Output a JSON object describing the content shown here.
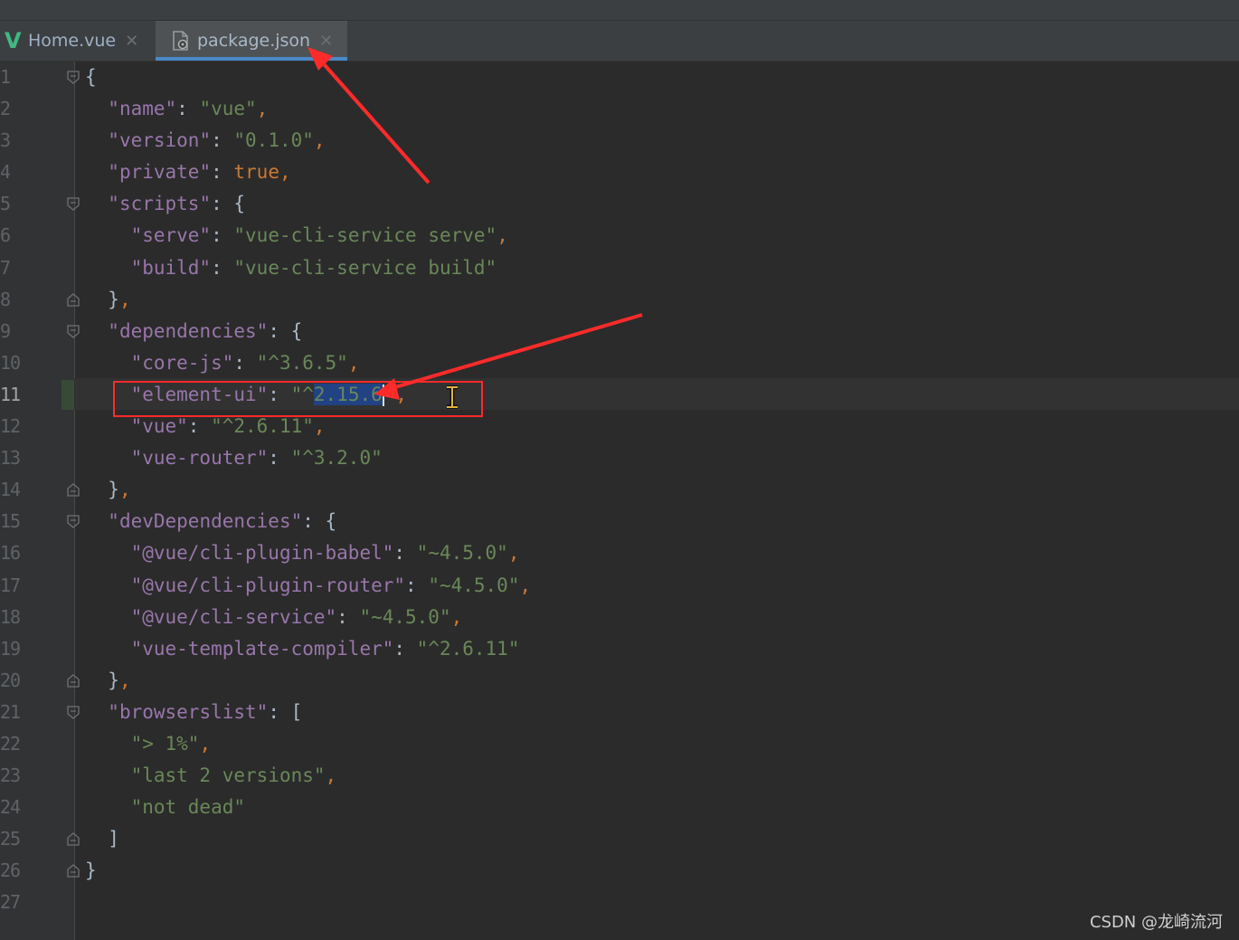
{
  "tabs": [
    {
      "label": "Home.vue",
      "icon": "vue-icon",
      "active": false
    },
    {
      "label": "package.json",
      "icon": "json-file-icon",
      "active": true
    }
  ],
  "editor": {
    "current_line": 11,
    "lines": [
      {
        "n": "1",
        "tokens": [
          {
            "t": "brace",
            "v": "{"
          }
        ]
      },
      {
        "n": "2",
        "tokens": [
          {
            "t": "ws",
            "v": "  "
          },
          {
            "t": "key",
            "v": "\"name\""
          },
          {
            "t": "brace",
            "v": ": "
          },
          {
            "t": "str",
            "v": "\"vue\""
          },
          {
            "t": "punc",
            "v": ","
          }
        ]
      },
      {
        "n": "3",
        "tokens": [
          {
            "t": "ws",
            "v": "  "
          },
          {
            "t": "key",
            "v": "\"version\""
          },
          {
            "t": "brace",
            "v": ": "
          },
          {
            "t": "str",
            "v": "\"0.1.0\""
          },
          {
            "t": "punc",
            "v": ","
          }
        ]
      },
      {
        "n": "4",
        "tokens": [
          {
            "t": "ws",
            "v": "  "
          },
          {
            "t": "key",
            "v": "\"private\""
          },
          {
            "t": "brace",
            "v": ": "
          },
          {
            "t": "kw",
            "v": "true"
          },
          {
            "t": "punc",
            "v": ","
          }
        ]
      },
      {
        "n": "5",
        "tokens": [
          {
            "t": "ws",
            "v": "  "
          },
          {
            "t": "key",
            "v": "\"scripts\""
          },
          {
            "t": "brace",
            "v": ": {"
          }
        ]
      },
      {
        "n": "6",
        "tokens": [
          {
            "t": "ws",
            "v": "    "
          },
          {
            "t": "key",
            "v": "\"serve\""
          },
          {
            "t": "brace",
            "v": ": "
          },
          {
            "t": "str",
            "v": "\"vue-cli-service serve\""
          },
          {
            "t": "punc",
            "v": ","
          }
        ]
      },
      {
        "n": "7",
        "tokens": [
          {
            "t": "ws",
            "v": "    "
          },
          {
            "t": "key",
            "v": "\"build\""
          },
          {
            "t": "brace",
            "v": ": "
          },
          {
            "t": "str",
            "v": "\"vue-cli-service build\""
          }
        ]
      },
      {
        "n": "8",
        "tokens": [
          {
            "t": "ws",
            "v": "  "
          },
          {
            "t": "brace",
            "v": "}"
          },
          {
            "t": "punc",
            "v": ","
          }
        ]
      },
      {
        "n": "9",
        "tokens": [
          {
            "t": "ws",
            "v": "  "
          },
          {
            "t": "key",
            "v": "\"dependencies\""
          },
          {
            "t": "brace",
            "v": ": {"
          }
        ]
      },
      {
        "n": "10",
        "tokens": [
          {
            "t": "ws",
            "v": "    "
          },
          {
            "t": "key",
            "v": "\"core-js\""
          },
          {
            "t": "brace",
            "v": ": "
          },
          {
            "t": "str",
            "v": "\"^3.6.5\""
          },
          {
            "t": "punc",
            "v": ","
          }
        ]
      },
      {
        "n": "11",
        "tokens": [
          {
            "t": "ws",
            "v": "    "
          },
          {
            "t": "key",
            "v": "\"element-ui\""
          },
          {
            "t": "brace",
            "v": ": "
          },
          {
            "t": "str",
            "v": "\"^"
          },
          {
            "t": "sel",
            "v": "2.15.6"
          },
          {
            "t": "caret",
            "v": ""
          },
          {
            "t": "str",
            "v": "\""
          },
          {
            "t": "punc",
            "v": ","
          }
        ]
      },
      {
        "n": "12",
        "tokens": [
          {
            "t": "ws",
            "v": "    "
          },
          {
            "t": "key",
            "v": "\"vue\""
          },
          {
            "t": "brace",
            "v": ": "
          },
          {
            "t": "str",
            "v": "\"^2.6.11\""
          },
          {
            "t": "punc",
            "v": ","
          }
        ]
      },
      {
        "n": "13",
        "tokens": [
          {
            "t": "ws",
            "v": "    "
          },
          {
            "t": "key",
            "v": "\"vue-router\""
          },
          {
            "t": "brace",
            "v": ": "
          },
          {
            "t": "str",
            "v": "\"^3.2.0\""
          }
        ]
      },
      {
        "n": "14",
        "tokens": [
          {
            "t": "ws",
            "v": "  "
          },
          {
            "t": "brace",
            "v": "}"
          },
          {
            "t": "punc",
            "v": ","
          }
        ]
      },
      {
        "n": "15",
        "tokens": [
          {
            "t": "ws",
            "v": "  "
          },
          {
            "t": "key",
            "v": "\"devDependencies\""
          },
          {
            "t": "brace",
            "v": ": {"
          }
        ]
      },
      {
        "n": "16",
        "tokens": [
          {
            "t": "ws",
            "v": "    "
          },
          {
            "t": "key",
            "v": "\"@vue/cli-plugin-babel\""
          },
          {
            "t": "brace",
            "v": ": "
          },
          {
            "t": "str",
            "v": "\"~4.5.0\""
          },
          {
            "t": "punc",
            "v": ","
          }
        ]
      },
      {
        "n": "17",
        "tokens": [
          {
            "t": "ws",
            "v": "    "
          },
          {
            "t": "key",
            "v": "\"@vue/cli-plugin-router\""
          },
          {
            "t": "brace",
            "v": ": "
          },
          {
            "t": "str",
            "v": "\"~4.5.0\""
          },
          {
            "t": "punc",
            "v": ","
          }
        ]
      },
      {
        "n": "18",
        "tokens": [
          {
            "t": "ws",
            "v": "    "
          },
          {
            "t": "key",
            "v": "\"@vue/cli-service\""
          },
          {
            "t": "brace",
            "v": ": "
          },
          {
            "t": "str",
            "v": "\"~4.5.0\""
          },
          {
            "t": "punc",
            "v": ","
          }
        ]
      },
      {
        "n": "19",
        "tokens": [
          {
            "t": "ws",
            "v": "    "
          },
          {
            "t": "key",
            "v": "\"vue-template-compiler\""
          },
          {
            "t": "brace",
            "v": ": "
          },
          {
            "t": "str",
            "v": "\"^2.6.11\""
          }
        ]
      },
      {
        "n": "20",
        "tokens": [
          {
            "t": "ws",
            "v": "  "
          },
          {
            "t": "brace",
            "v": "}"
          },
          {
            "t": "punc",
            "v": ","
          }
        ]
      },
      {
        "n": "21",
        "tokens": [
          {
            "t": "ws",
            "v": "  "
          },
          {
            "t": "key",
            "v": "\"browserslist\""
          },
          {
            "t": "brace",
            "v": ": ["
          }
        ]
      },
      {
        "n": "22",
        "tokens": [
          {
            "t": "ws",
            "v": "    "
          },
          {
            "t": "str",
            "v": "\"> 1%\""
          },
          {
            "t": "punc",
            "v": ","
          }
        ]
      },
      {
        "n": "23",
        "tokens": [
          {
            "t": "ws",
            "v": "    "
          },
          {
            "t": "str",
            "v": "\"last 2 versions\""
          },
          {
            "t": "punc",
            "v": ","
          }
        ]
      },
      {
        "n": "24",
        "tokens": [
          {
            "t": "ws",
            "v": "    "
          },
          {
            "t": "str",
            "v": "\"not dead\""
          }
        ]
      },
      {
        "n": "25",
        "tokens": [
          {
            "t": "ws",
            "v": "  "
          },
          {
            "t": "brace",
            "v": "]"
          }
        ]
      },
      {
        "n": "26",
        "tokens": [
          {
            "t": "brace",
            "v": "}"
          }
        ]
      },
      {
        "n": "27",
        "tokens": []
      }
    ],
    "fold_markers": {
      "1": "open",
      "5": "open",
      "8": "close",
      "9": "open",
      "14": "close",
      "15": "open",
      "20": "close",
      "21": "open",
      "25": "close",
      "26": "close"
    }
  },
  "watermark": "CSDN @龙崎流河",
  "colors": {
    "annotation": "#ff2a2a",
    "key": "#9876aa",
    "string": "#6a8759",
    "keyword": "#cc7832",
    "selection": "#214283"
  }
}
